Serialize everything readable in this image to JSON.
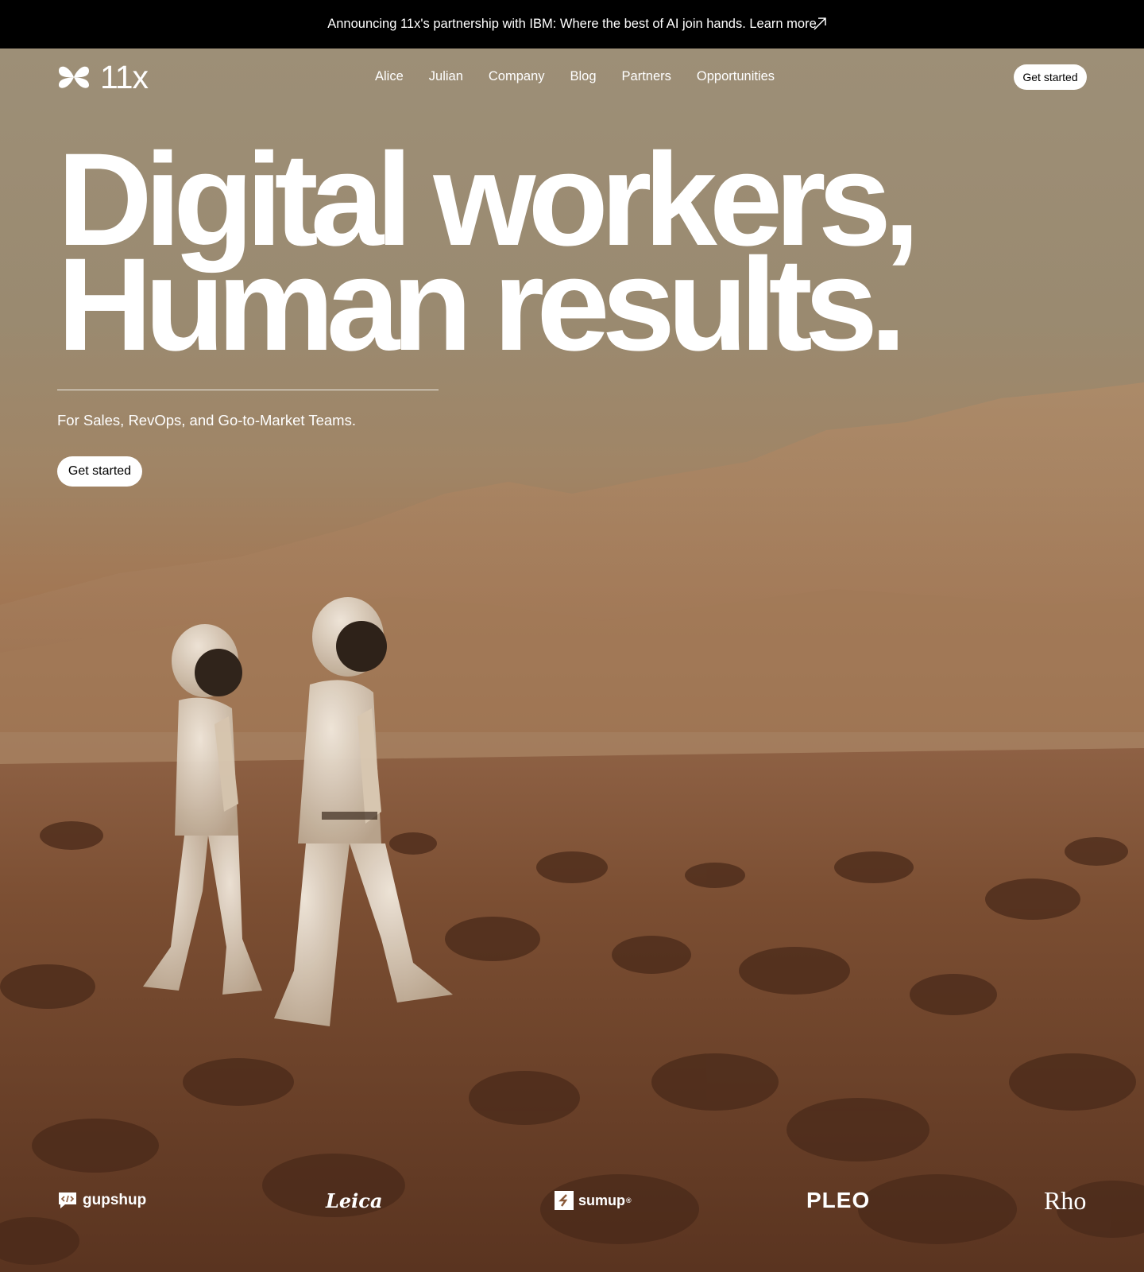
{
  "announcement": {
    "text": "Announcing 11x's partnership with IBM: Where the best of AI join hands. Learn more",
    "icon": "arrow-up-right-icon"
  },
  "nav": {
    "logo_text": "11x",
    "logo_icon": "butterfly-mark-icon",
    "links": [
      "Alice",
      "Julian",
      "Company",
      "Blog",
      "Partners",
      "Opportunities"
    ],
    "cta_label": "Get started"
  },
  "hero": {
    "headline_line1": "Digital workers,",
    "headline_line2": "Human results.",
    "tagline": "For Sales, RevOps, and Go-to-Market Teams.",
    "cta_label": "Get started",
    "background": "astronauts-walking-on-desert-photo"
  },
  "logos": {
    "items": [
      "gupshup",
      "Leica",
      "sumup",
      "PLEO",
      "Rho"
    ],
    "sumup_suffix": "®"
  },
  "colors": {
    "announcement_bg": "#000000",
    "hero_tone": "#a27855",
    "button_bg": "#ffffff",
    "button_text": "#000000"
  }
}
